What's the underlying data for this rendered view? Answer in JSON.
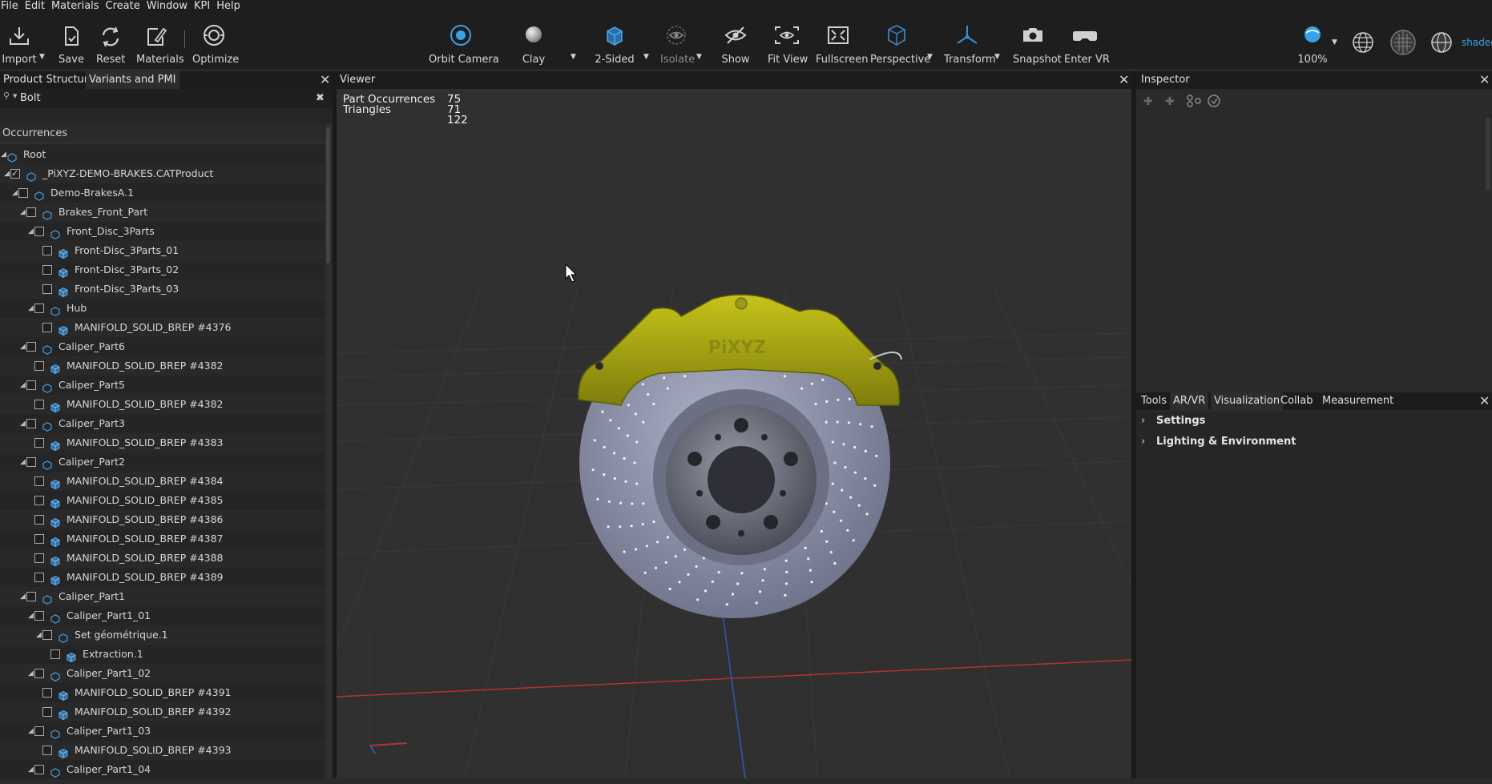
{
  "menu": [
    "File",
    "Edit",
    "Materials",
    "Create",
    "Window",
    "KPI",
    "Help"
  ],
  "toolbar": {
    "import": "Import",
    "save": "Save",
    "reset": "Reset",
    "materials": "Materials",
    "optimize": "Optimize",
    "orbit_camera": "Orbit Camera",
    "clay": "Clay",
    "two_sided": "2-Sided",
    "isolate": "Isolate",
    "show": "Show",
    "fit_view": "Fit View",
    "fullscreen": "Fullscreen",
    "perspective": "Perspective",
    "transform": "Transform",
    "snapshot": "Snapshot",
    "enter_vr": "Enter VR",
    "zoom": "100%",
    "shaded": "shaded"
  },
  "left_panel": {
    "tabs": [
      "Product Structure",
      "Variants and PMI"
    ],
    "search_value": "Bolt",
    "occurrences_header": "Occurrences",
    "tree": [
      {
        "label": "Root",
        "depth": 0,
        "expanded": true,
        "checkbox": false,
        "checked": false,
        "icon": "assembly-icon"
      },
      {
        "label": "_PiXYZ-DEMO-BRAKES.CATProduct",
        "depth": 1,
        "expanded": true,
        "checkbox": true,
        "checked": true,
        "icon": "assembly-icon"
      },
      {
        "label": "Demo-BrakesA.1",
        "depth": 2,
        "expanded": true,
        "checkbox": true,
        "checked": false,
        "icon": "assembly-icon"
      },
      {
        "label": "Brakes_Front_Part",
        "depth": 3,
        "expanded": true,
        "checkbox": true,
        "checked": false,
        "icon": "assembly-icon"
      },
      {
        "label": "Front_Disc_3Parts",
        "depth": 4,
        "expanded": true,
        "checkbox": true,
        "checked": false,
        "icon": "assembly-icon"
      },
      {
        "label": "Front-Disc_3Parts_01",
        "depth": 5,
        "expanded": null,
        "checkbox": true,
        "checked": false,
        "icon": "part-icon"
      },
      {
        "label": "Front-Disc_3Parts_02",
        "depth": 5,
        "expanded": null,
        "checkbox": true,
        "checked": false,
        "icon": "part-icon"
      },
      {
        "label": "Front-Disc_3Parts_03",
        "depth": 5,
        "expanded": null,
        "checkbox": true,
        "checked": false,
        "icon": "part-icon"
      },
      {
        "label": "Hub",
        "depth": 4,
        "expanded": true,
        "checkbox": true,
        "checked": false,
        "icon": "assembly-icon"
      },
      {
        "label": "MANIFOLD_SOLID_BREP #4376",
        "depth": 5,
        "expanded": null,
        "checkbox": true,
        "checked": false,
        "icon": "part-icon"
      },
      {
        "label": "Caliper_Part6",
        "depth": 3,
        "expanded": true,
        "checkbox": true,
        "checked": false,
        "icon": "assembly-icon"
      },
      {
        "label": "MANIFOLD_SOLID_BREP #4382",
        "depth": 4,
        "expanded": null,
        "checkbox": true,
        "checked": false,
        "icon": "part-icon"
      },
      {
        "label": "Caliper_Part5",
        "depth": 3,
        "expanded": true,
        "checkbox": true,
        "checked": false,
        "icon": "assembly-icon"
      },
      {
        "label": "MANIFOLD_SOLID_BREP #4382",
        "depth": 4,
        "expanded": null,
        "checkbox": true,
        "checked": false,
        "icon": "part-icon"
      },
      {
        "label": "Caliper_Part3",
        "depth": 3,
        "expanded": true,
        "checkbox": true,
        "checked": false,
        "icon": "assembly-icon"
      },
      {
        "label": "MANIFOLD_SOLID_BREP #4383",
        "depth": 4,
        "expanded": null,
        "checkbox": true,
        "checked": false,
        "icon": "part-icon"
      },
      {
        "label": "Caliper_Part2",
        "depth": 3,
        "expanded": true,
        "checkbox": true,
        "checked": false,
        "icon": "assembly-icon"
      },
      {
        "label": "MANIFOLD_SOLID_BREP #4384",
        "depth": 4,
        "expanded": null,
        "checkbox": true,
        "checked": false,
        "icon": "part-icon"
      },
      {
        "label": "MANIFOLD_SOLID_BREP #4385",
        "depth": 4,
        "expanded": null,
        "checkbox": true,
        "checked": false,
        "icon": "part-icon"
      },
      {
        "label": "MANIFOLD_SOLID_BREP #4386",
        "depth": 4,
        "expanded": null,
        "checkbox": true,
        "checked": false,
        "icon": "part-icon"
      },
      {
        "label": "MANIFOLD_SOLID_BREP #4387",
        "depth": 4,
        "expanded": null,
        "checkbox": true,
        "checked": false,
        "icon": "part-icon"
      },
      {
        "label": "MANIFOLD_SOLID_BREP #4388",
        "depth": 4,
        "expanded": null,
        "checkbox": true,
        "checked": false,
        "icon": "part-icon"
      },
      {
        "label": "MANIFOLD_SOLID_BREP #4389",
        "depth": 4,
        "expanded": null,
        "checkbox": true,
        "checked": false,
        "icon": "part-icon"
      },
      {
        "label": "Caliper_Part1",
        "depth": 3,
        "expanded": true,
        "checkbox": true,
        "checked": false,
        "icon": "assembly-icon"
      },
      {
        "label": "Caliper_Part1_01",
        "depth": 4,
        "expanded": true,
        "checkbox": true,
        "checked": false,
        "icon": "assembly-icon"
      },
      {
        "label": "Set géométrique.1",
        "depth": 5,
        "expanded": true,
        "checkbox": true,
        "checked": false,
        "icon": "assembly-icon"
      },
      {
        "label": "Extraction.1",
        "depth": 6,
        "expanded": null,
        "checkbox": true,
        "checked": false,
        "icon": "part-icon"
      },
      {
        "label": "Caliper_Part1_02",
        "depth": 4,
        "expanded": true,
        "checkbox": true,
        "checked": false,
        "icon": "assembly-icon"
      },
      {
        "label": "MANIFOLD_SOLID_BREP #4391",
        "depth": 5,
        "expanded": null,
        "checkbox": true,
        "checked": false,
        "icon": "part-icon"
      },
      {
        "label": "MANIFOLD_SOLID_BREP #4392",
        "depth": 5,
        "expanded": null,
        "checkbox": true,
        "checked": false,
        "icon": "part-icon"
      },
      {
        "label": "Caliper_Part1_03",
        "depth": 4,
        "expanded": true,
        "checkbox": true,
        "checked": false,
        "icon": "assembly-icon"
      },
      {
        "label": "MANIFOLD_SOLID_BREP #4393",
        "depth": 5,
        "expanded": null,
        "checkbox": true,
        "checked": false,
        "icon": "part-icon"
      },
      {
        "label": "Caliper_Part1_04",
        "depth": 4,
        "expanded": true,
        "checkbox": true,
        "checked": false,
        "icon": "assembly-icon"
      }
    ]
  },
  "viewer": {
    "tab": "Viewer",
    "stats": [
      {
        "label": "Part Occurrences",
        "value": "75"
      },
      {
        "label": "Triangles",
        "value": "71 122"
      }
    ],
    "caliper_text": "PiXYZ"
  },
  "inspector": {
    "tab": "Inspector"
  },
  "bottom_panel": {
    "tabs": [
      "Tools",
      "AR/VR",
      "Visualization",
      "Collab",
      "Measurement"
    ],
    "active_tab": "Visualization",
    "sections": [
      "Settings",
      "Lighting & Environment"
    ]
  },
  "colors": {
    "accent_blue": "#3aa0e8",
    "caliper_yellow": "#b8b814",
    "disc_grey": "#8a8fa8",
    "axis_red": "#c03030",
    "axis_blue": "#2a60c0"
  }
}
